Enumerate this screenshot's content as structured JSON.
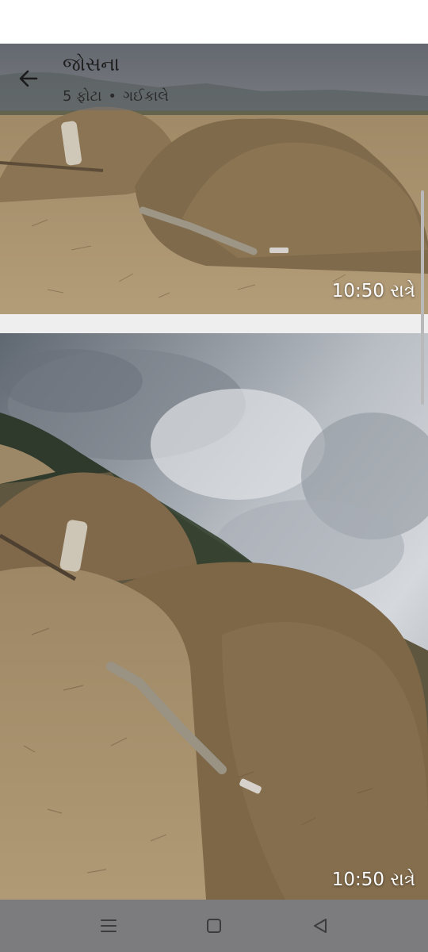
{
  "header": {
    "title": "જોસના",
    "photo_count": "5 ફોટા",
    "separator": "•",
    "date": "ગઈકાલે"
  },
  "photos": [
    {
      "time": "10:50 રાત્રે"
    },
    {
      "time": "10:50 રાત્રે"
    }
  ],
  "icons": {
    "back": "arrow-left-icon",
    "nav_menu": "menu-icon",
    "nav_home": "home-square-icon",
    "nav_back": "triangle-back-icon"
  },
  "colors": {
    "app_bar": "#696e76",
    "nav_bar": "#7c7c7e",
    "divider": "#efeeee"
  }
}
